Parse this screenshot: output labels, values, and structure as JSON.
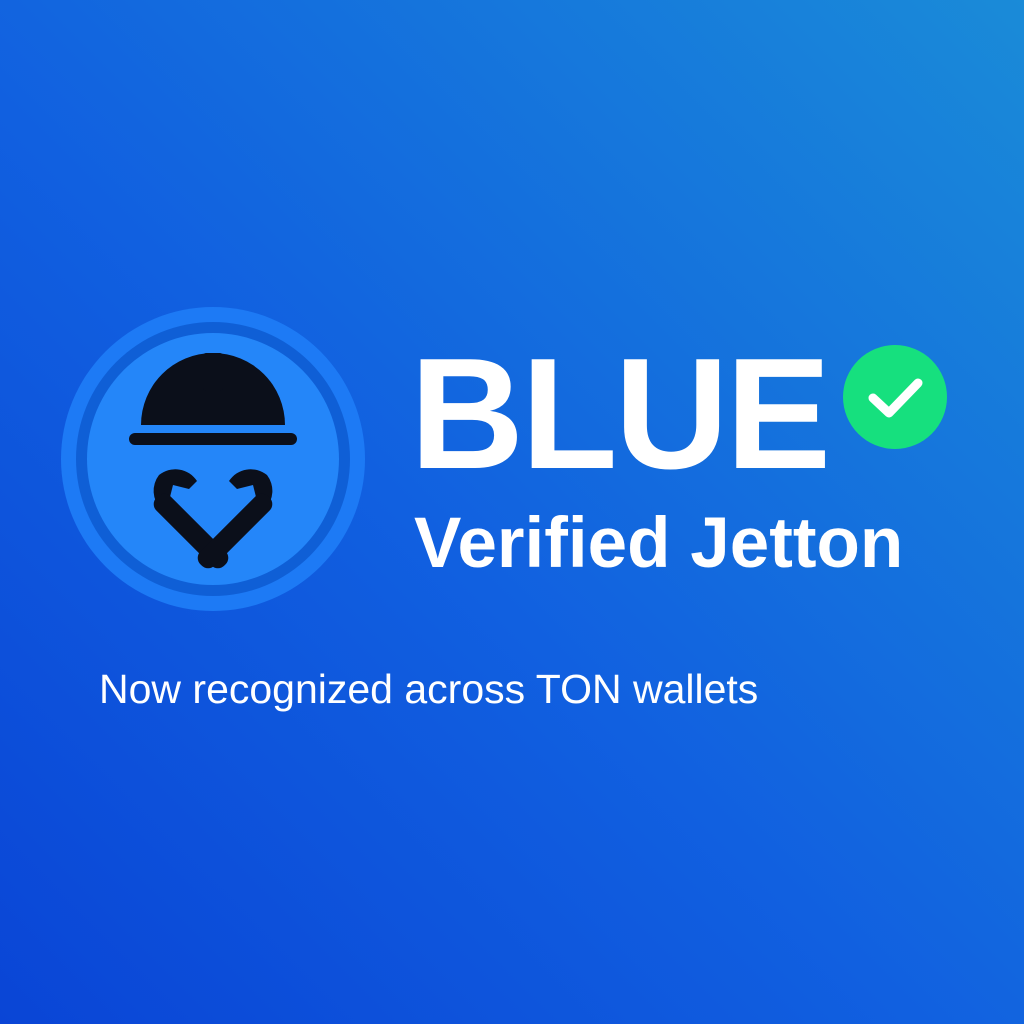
{
  "token": {
    "name": "BLUE",
    "subtitle": "Verified Jetton",
    "tagline": "Now recognized across TON wallets"
  },
  "logo": {
    "icon": "worker-helmet-crossed-wrenches-icon",
    "colors": {
      "outer_ring": "#1d7af5",
      "inner_ring": "#0f5fd6",
      "disc": "#2486f9",
      "glyph": "#0b0f1a"
    }
  },
  "badge": {
    "icon": "checkmark-icon",
    "color": "#16e07e"
  },
  "colors": {
    "background_start": "#0a45d6",
    "background_end": "#1a8bd8",
    "text": "#ffffff"
  }
}
